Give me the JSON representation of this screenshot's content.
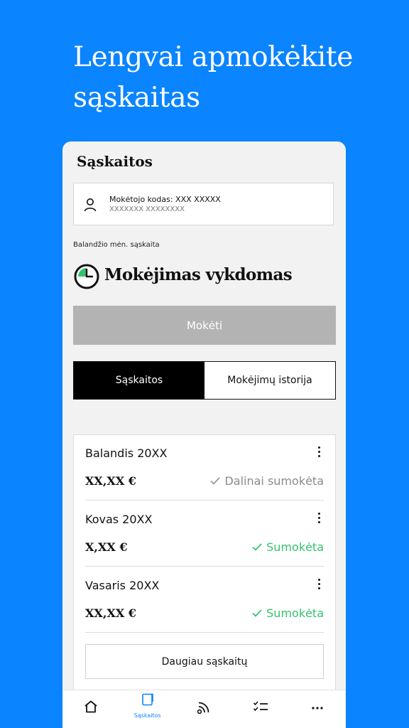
{
  "headline": "Lengvai apmokėkite sąskaitas",
  "screen_title": "Sąskaitos",
  "payer": {
    "code": "Mokėtojo kodas: XXX XXXXX",
    "name": "XXXXXXX XXXXXXXX"
  },
  "month_label": "Balandžio mėn. sąskaita",
  "status_heading": "Mokėjimas vykdomas",
  "pay_button": "Mokėti",
  "segments": [
    "Sąskaitos",
    "Mokėjimų istorija"
  ],
  "bills": [
    {
      "month": "Balandis 20XX",
      "amount": "XX,XX €",
      "status": "Dalinai sumokėta",
      "status_color": "#8a8a8a"
    },
    {
      "month": "Kovas 20XX",
      "amount": "X,XX €",
      "status": "Sumokėta",
      "status_color": "#35c26e"
    },
    {
      "month": "Vasaris 20XX",
      "amount": "XX,XX €",
      "status": "Sumokėta",
      "status_color": "#35c26e"
    }
  ],
  "more_button": "Daugiau sąskaitų",
  "tabbar": {
    "items": [
      {
        "icon": "home-icon",
        "label": ""
      },
      {
        "icon": "bills-icon",
        "label": "Sąskaitos"
      },
      {
        "icon": "feed-icon",
        "label": ""
      },
      {
        "icon": "tasks-icon",
        "label": ""
      },
      {
        "icon": "more-icon",
        "label": ""
      }
    ]
  },
  "colors": {
    "background": "#0a84ff",
    "accent": "#0a84ff",
    "paid": "#35c26e",
    "partial": "#8a8a8a",
    "clock_green": "#35c26e"
  }
}
